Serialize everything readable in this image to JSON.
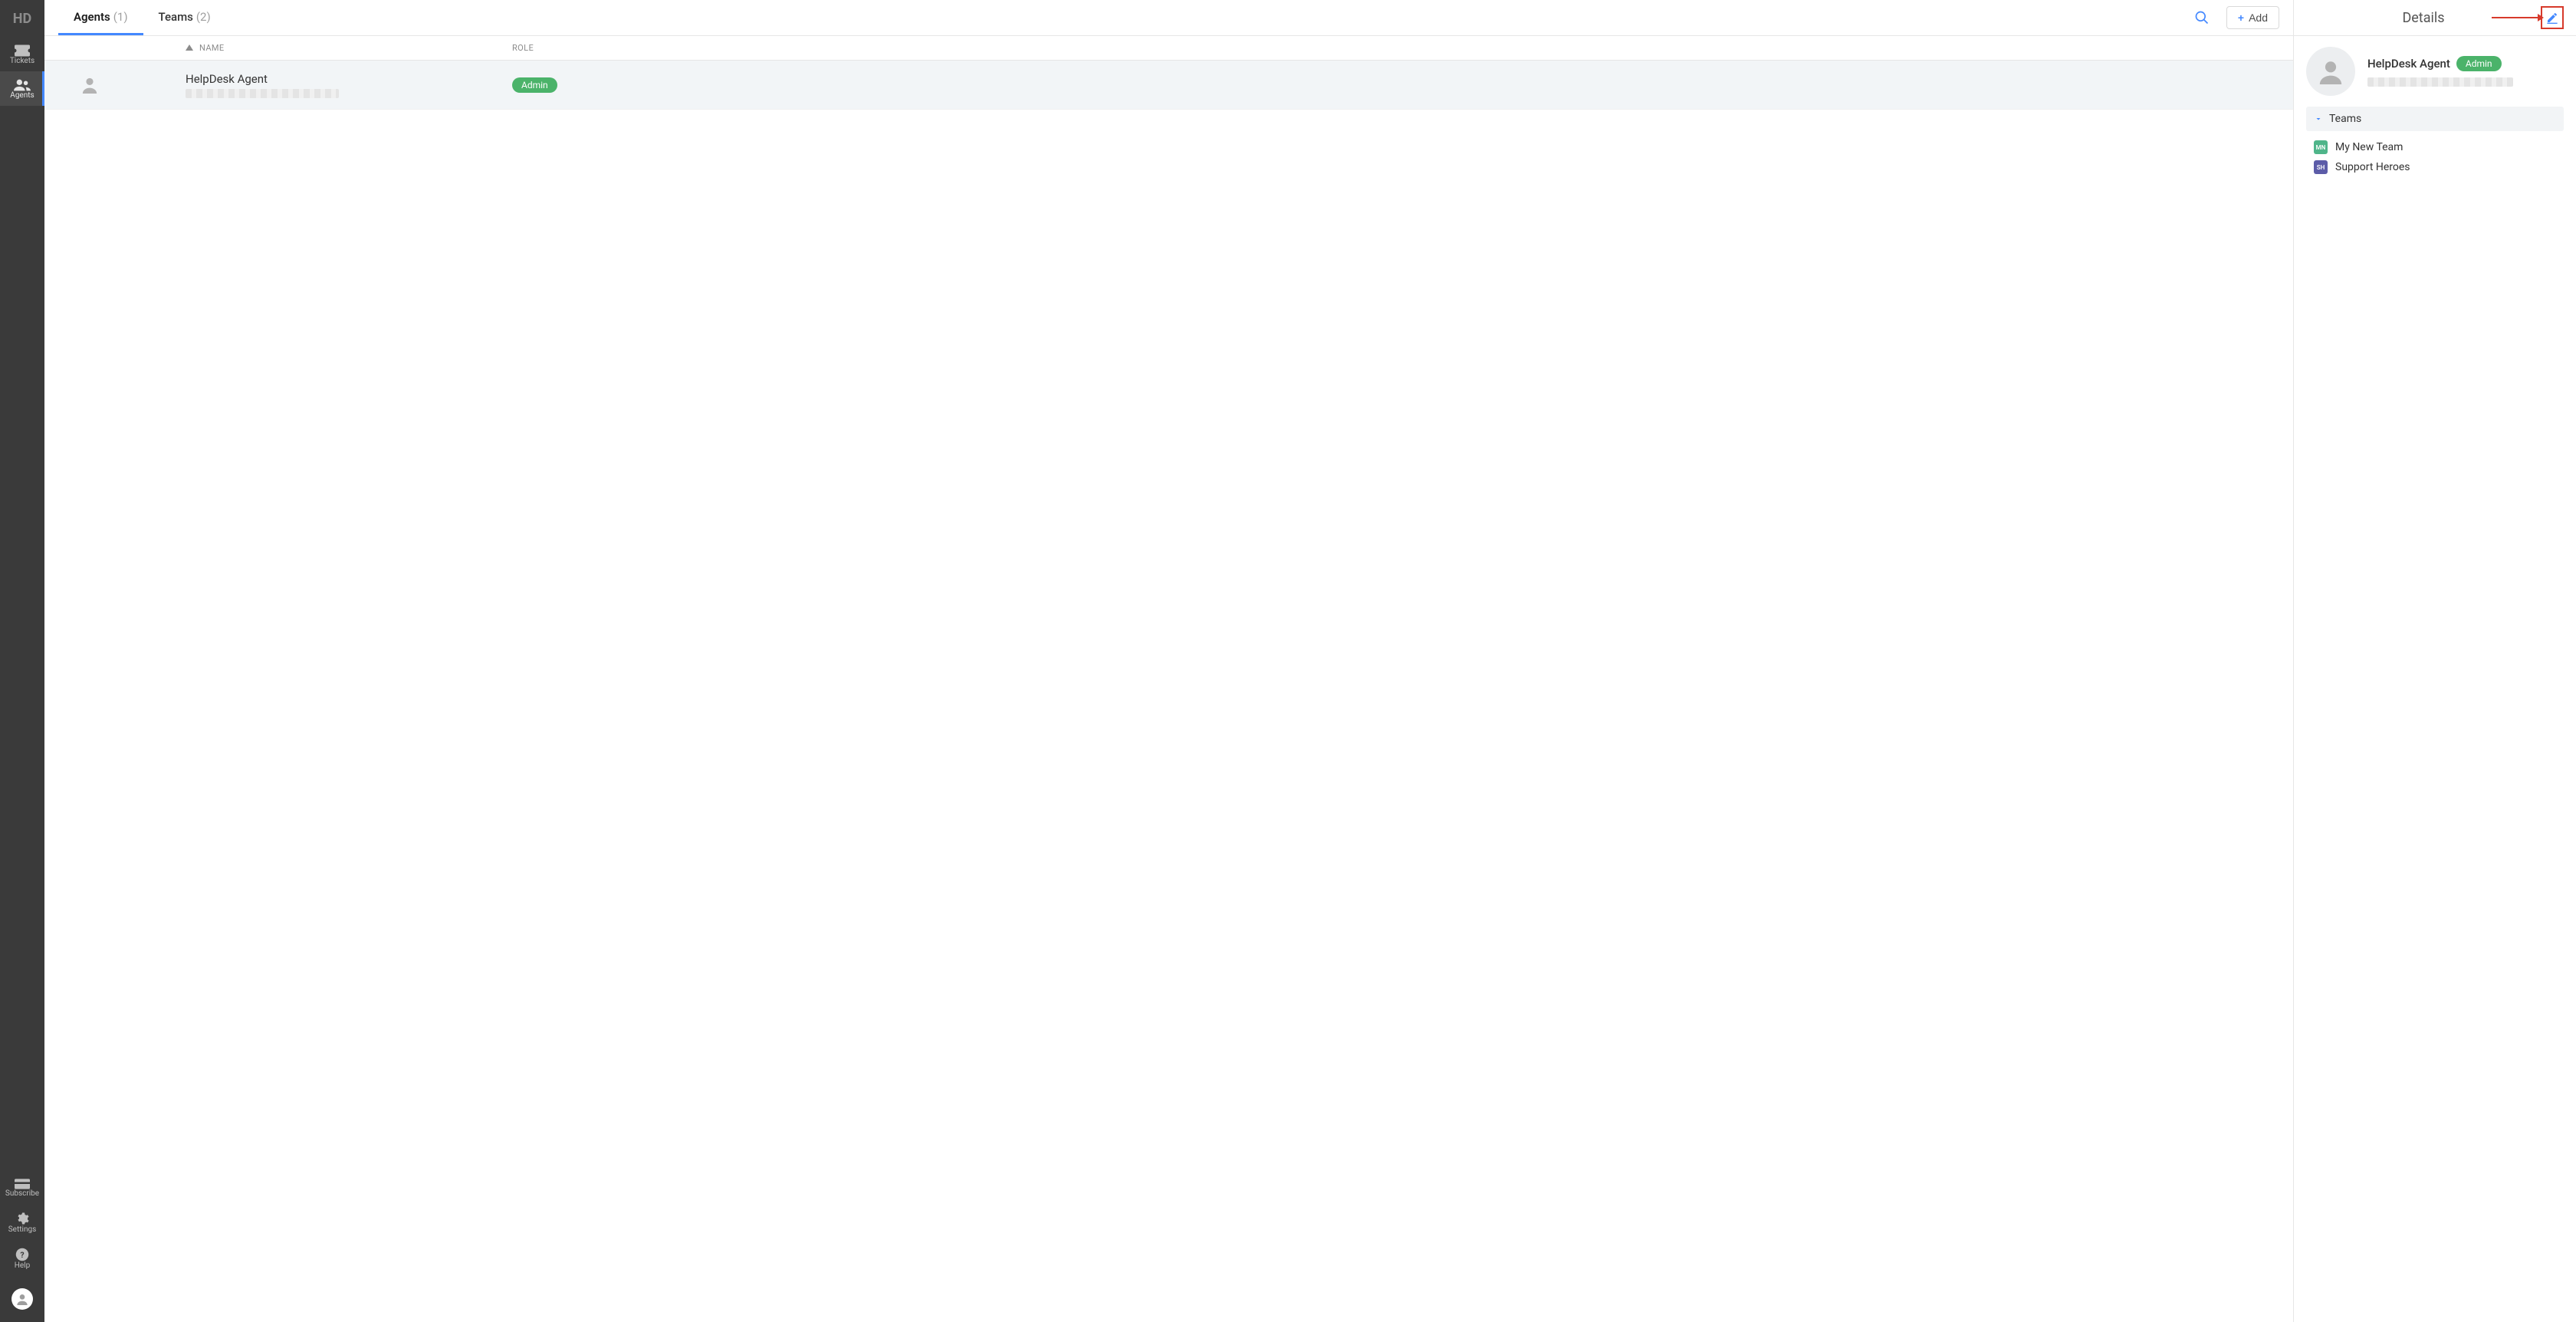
{
  "brand": {
    "logo_text": "HD"
  },
  "sidebar": {
    "tickets_label": "Tickets",
    "agents_label": "Agents",
    "subscribe_label": "Subscribe",
    "settings_label": "Settings",
    "help_label": "Help"
  },
  "tabs": {
    "agents_label": "Agents",
    "agents_count": "(1)",
    "teams_label": "Teams",
    "teams_count": "(2)"
  },
  "toolbar": {
    "add_label": "Add"
  },
  "table": {
    "col_name": "NAME",
    "col_role": "ROLE",
    "rows": [
      {
        "name": "HelpDesk Agent",
        "role_badge": "Admin"
      }
    ]
  },
  "details": {
    "title": "Details",
    "agent_name": "HelpDesk Agent",
    "agent_role_badge": "Admin",
    "teams_section_label": "Teams",
    "teams": [
      {
        "initials": "MN",
        "name": "My New Team",
        "color": "#4fb58a"
      },
      {
        "initials": "SH",
        "name": "Support Heroes",
        "color": "#5c5ca8"
      }
    ]
  }
}
